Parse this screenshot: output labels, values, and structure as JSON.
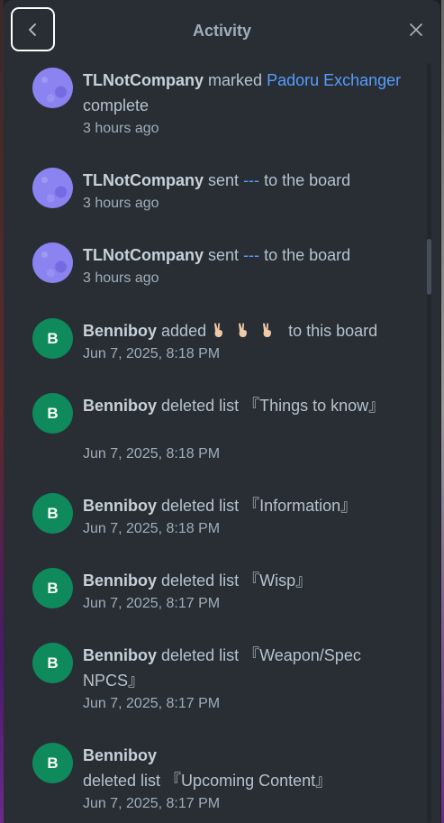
{
  "header": {
    "title": "Activity"
  },
  "entries": [
    {
      "user": "TLNotCompany",
      "avatar": "",
      "pre": "marked",
      "link": "Padoru Exchanger",
      "post": "complete",
      "time": "3 hours ago"
    },
    {
      "user": "TLNotCompany",
      "avatar": "",
      "pre": "sent",
      "link": "---",
      "post": "to the board",
      "time": "3 hours ago"
    },
    {
      "user": "TLNotCompany",
      "avatar": "",
      "pre": "sent",
      "link": "---",
      "post": "to the board",
      "time": "3 hours ago"
    },
    {
      "user": "Benniboy",
      "avatar": "B",
      "pre": "added",
      "emoji": "victory-hand-light-skin",
      "post": "to this board",
      "time": "Jun 7, 2025, 8:18 PM"
    },
    {
      "user": "Benniboy",
      "avatar": "B",
      "action": "deleted list 『Things to know』",
      "time": "Jun 7, 2025, 8:18 PM"
    },
    {
      "user": "Benniboy",
      "avatar": "B",
      "action": "deleted list 『Information』",
      "time": "Jun 7, 2025, 8:18 PM"
    },
    {
      "user": "Benniboy",
      "avatar": "B",
      "action": "deleted list 『Wisp』",
      "time": "Jun 7, 2025, 8:17 PM"
    },
    {
      "user": "Benniboy",
      "avatar": "B",
      "action": "deleted list 『Weapon/Spec NPCS』",
      "time": "Jun 7, 2025, 8:17 PM"
    },
    {
      "user": "Benniboy",
      "avatar": "B",
      "action": "deleted list 『Upcoming Content』",
      "time": "Jun 7, 2025, 8:17 PM"
    }
  ],
  "icons": {
    "back": "chevron-left-icon",
    "close": "close-icon",
    "emoji": "victory-hand-emoji"
  },
  "colors": {
    "link": "#579dff",
    "avatar_b": "#0e8a5c",
    "avatar_tl": "#8a83f0"
  }
}
